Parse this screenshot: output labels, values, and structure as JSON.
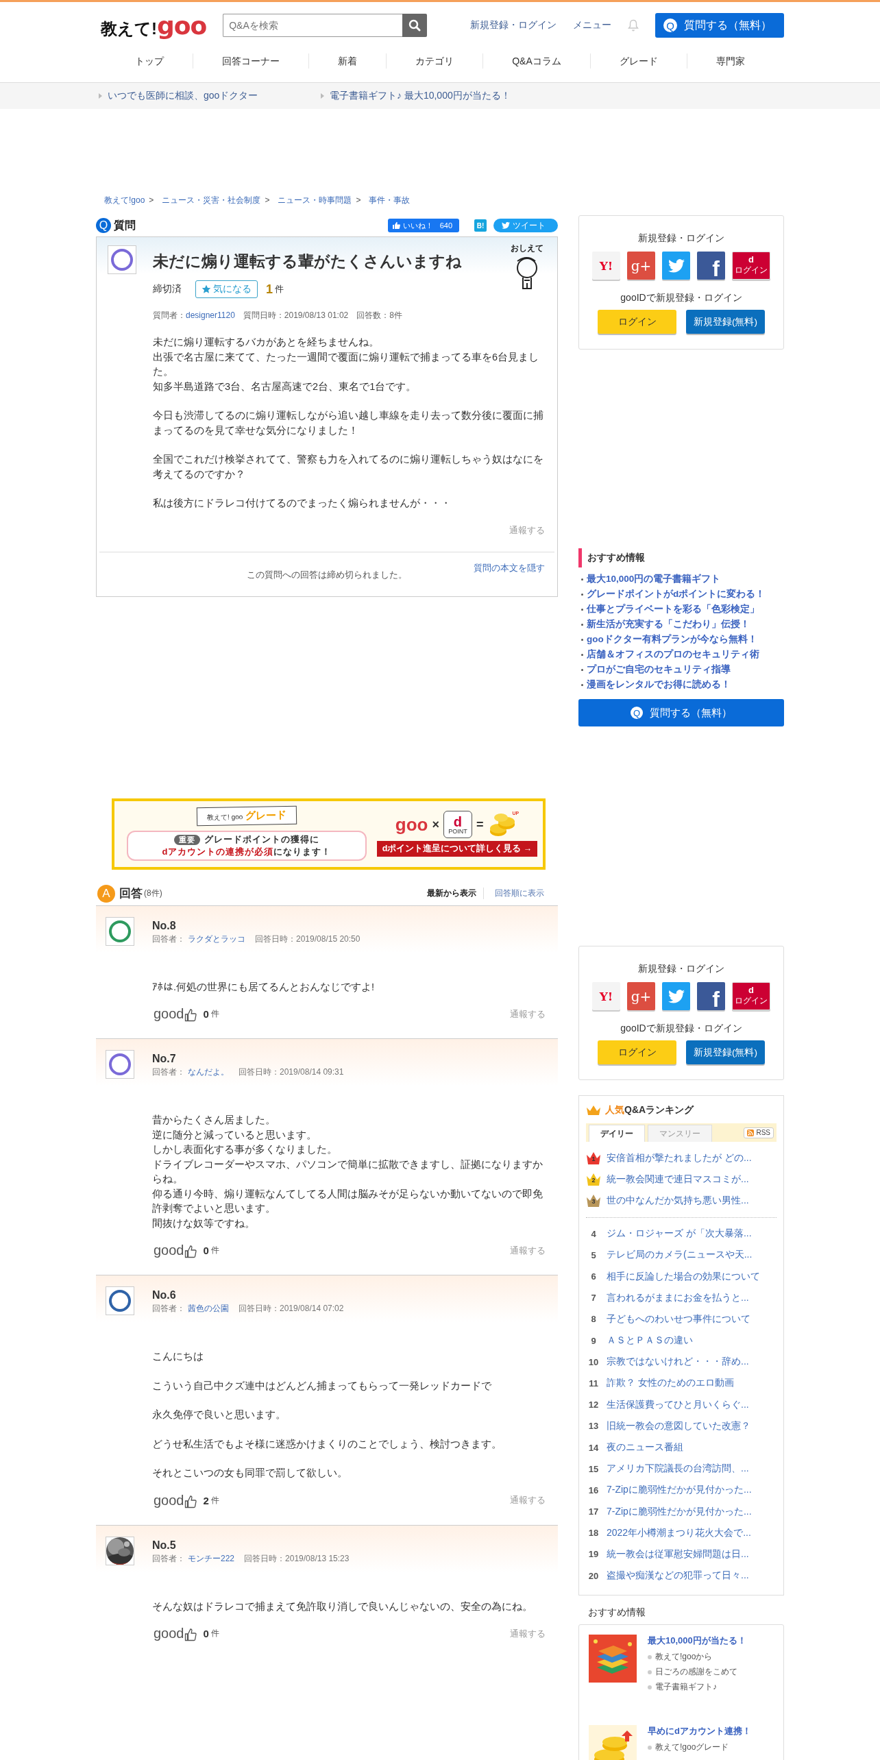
{
  "header": {
    "logo": {
      "text": "教えて!",
      "brand": "goo"
    },
    "search": {
      "placeholder": "Q&Aを検索"
    },
    "links": [
      "新規登録・ログイン",
      "メニュー"
    ],
    "ask_button": {
      "icon": "Q",
      "label": "質問する（無料）"
    },
    "nav": [
      "トップ",
      "回答コーナー",
      "新着",
      "カテゴリ",
      "Q&Aコラム",
      "グレード",
      "専門家"
    ]
  },
  "promo_links": [
    "いつでも医師に相談、gooドクター",
    "電子書籍ギフト♪ 最大10,000円が当たる！"
  ],
  "breadcrumb": [
    {
      "label": "教えて!goo",
      "sep": ">"
    },
    {
      "label": "ニュース・災害・社会制度",
      "sep": ">"
    },
    {
      "label": "ニュース・時事問題",
      "sep": ">"
    },
    {
      "label": "事件・事故"
    }
  ],
  "question": {
    "badge": "Q",
    "section_label": "質問",
    "like_label": "いいね！",
    "like_count": "640",
    "hatena": "B!",
    "tweet": "ツイート",
    "mascot_text": "おしえて",
    "avatar": {
      "color": "#7a6ad8"
    },
    "title": "未だに煽り運転する輩がたくさんいますね",
    "status": "締切済",
    "watch_button": "気になる",
    "watch_count": "1",
    "watch_unit": "件",
    "meta": [
      {
        "label": "質問者：",
        "value": "designer1120",
        "kind": "link"
      },
      {
        "label": "質問日時：",
        "value": "2019/08/13 01:02",
        "kind": "plain"
      },
      {
        "label": "回答数：",
        "value": "8件",
        "kind": "plain"
      }
    ],
    "body": [
      [
        "未だに煽り運転するバカがあとを経ちませんね。",
        "出張で名古屋に来てて、たった一週間で覆面に煽り運転で捕まってる車を6台見ました。",
        "知多半島道路で3台、名古屋高速で2台、東名で1台です。"
      ],
      [
        "今日も渋滞してるのに煽り運転しながら追い越し車線を走り去って数分後に覆面に捕まってるのを見て幸せな気分になりました！"
      ],
      [
        "全国でこれだけ検挙されてて、警察も力を入れてるのに煽り運転しちゃう奴はなにを考えてるのですか？"
      ],
      [
        "私は後方にドラレコ付けてるのでまったく煽られませんが・・・"
      ]
    ],
    "report": "通報する",
    "closed_notice": "この質問への回答は締め切られました。",
    "hide_link": "質問の本文を隠す"
  },
  "banner": {
    "ribbon_site": "教えて! goo",
    "ribbon_title": "グレード",
    "badge": "重要",
    "line1": "グレードポイントの獲得に",
    "line2_accent": "dアカウントの連携が必須",
    "line2_rest": "になります！",
    "goo": "goo",
    "times": "×",
    "dpoint_mark": "d",
    "dpoint_label": "POINT",
    "equals": "=",
    "up": "UP",
    "button": "dポイント進呈について詳しく見る →"
  },
  "answers_header": {
    "badge": "A",
    "label": "回答",
    "count": "(8件)",
    "sorts": [
      {
        "label": "最新から表示",
        "selected": true
      },
      {
        "label": "回答順に表示",
        "selected": false
      }
    ]
  },
  "answers": [
    {
      "number": "No.8",
      "avatar": {
        "kind": "icon",
        "color": "#2e9a5e"
      },
      "answerer_label": "回答者：",
      "answerer": "ラクダとラッコ",
      "date": "回答日時：2019/08/15 20:50",
      "body": [
        [
          "ｱﾎは.何処の世界にも居てるんとおんなじですよ!"
        ]
      ],
      "good": "good",
      "good_count": "0",
      "good_unit": "件",
      "report": "通報する"
    },
    {
      "number": "No.7",
      "avatar": {
        "kind": "icon",
        "color": "#7a6ad8"
      },
      "answerer_label": "回答者：",
      "answerer": "なんだよ。",
      "date": "回答日時：2019/08/14 09:31",
      "body": [
        [
          "昔からたくさん居ました。",
          "逆に随分と減っていると思います。",
          "しかし表面化する事が多くなりました。",
          "ドライブレコーダーやスマホ、パソコンで簡単に拡散できますし、証拠になりますからね。",
          "仰る通り今時、煽り運転なんてしてる人間は脳みそが足らないか動いてないので即免許剥奪でよいと思います。",
          "間抜けな奴等ですね。"
        ]
      ],
      "good": "good",
      "good_count": "0",
      "good_unit": "件",
      "report": "通報する"
    },
    {
      "number": "No.6",
      "avatar": {
        "kind": "icon",
        "color": "#2f63a8"
      },
      "answerer_label": "回答者：",
      "answerer": "茜色の公園",
      "date": "回答日時：2019/08/14 07:02",
      "body": [
        [
          "こんにちは"
        ],
        [
          "こういう自己中クズ連中はどんどん捕まってもらって一発レッドカードで"
        ],
        [
          "永久免停で良いと思います。"
        ],
        [
          "どうせ私生活でもよそ様に迷惑かけまくりのことでしょう、検討つきます。"
        ],
        [
          "それとこいつの女も同罪で罰して欲しい。"
        ]
      ],
      "good": "good",
      "good_count": "2",
      "good_unit": "件",
      "report": "通報する"
    },
    {
      "number": "No.5",
      "avatar": {
        "kind": "picture"
      },
      "answerer_label": "回答者：",
      "answerer": "モンチー222",
      "date": "回答日時：2019/08/13 15:23",
      "body": [
        [
          "そんな奴はドラレコで捕まえて免許取り消しで良いんじゃないの、安全の為にね。"
        ]
      ],
      "good": "good",
      "good_count": "0",
      "good_unit": "件",
      "report": "通報する"
    }
  ],
  "login_boxes": [
    {
      "title": "新規登録・ログイン",
      "social": [
        {
          "kind": "yahoo",
          "label": "Y!"
        },
        {
          "kind": "google",
          "label": "g+"
        },
        {
          "kind": "twitter"
        },
        {
          "kind": "facebook",
          "label": "f"
        },
        {
          "kind": "docomo",
          "label": "d",
          "sub": "ログイン"
        }
      ],
      "goo_title": "gooIDで新規登録・ログイン",
      "login": "ログイン",
      "register": "新規登録(無料)"
    },
    {
      "title": "新規登録・ログイン",
      "social": [
        {
          "kind": "yahoo",
          "label": "Y!"
        },
        {
          "kind": "google",
          "label": "g+"
        },
        {
          "kind": "twitter"
        },
        {
          "kind": "facebook",
          "label": "f"
        },
        {
          "kind": "docomo",
          "label": "d",
          "sub": "ログイン"
        }
      ],
      "goo_title": "gooIDで新規登録・ログイン",
      "login": "ログイン",
      "register": "新規登録(無料)"
    }
  ],
  "recommend": {
    "title": "おすすめ情報",
    "items": [
      "最大10,000円の電子書籍ギフト",
      "グレードポイントがdポイントに変わる！",
      "仕事とプライベートを彩る「色彩検定」",
      "新生活が充実する「こだわり」伝授！",
      "gooドクター有料プランが今なら無料！",
      "店舗＆オフィスのプロのセキュリティ術",
      "プロがご自宅のセキュリティ指導",
      "漫画をレンタルでお得に読める！"
    ]
  },
  "side_ask_button": {
    "icon": "Q",
    "label": "質問する（無料）"
  },
  "ranking": {
    "title_accent": "人気",
    "title": "Q&Aランキング",
    "tabs": [
      {
        "label": "デイリー",
        "selected": true
      },
      {
        "label": "マンスリー",
        "selected": false
      }
    ],
    "rss": "RSS",
    "items": [
      {
        "rank": "1",
        "kind": "crown",
        "color": "#e8382f",
        "title": "安倍首相が撃たれましたが どの..."
      },
      {
        "rank": "2",
        "kind": "crown",
        "color": "#f2c21b",
        "title": "統一教会関連で連日マスコミが..."
      },
      {
        "rank": "3",
        "kind": "crown",
        "color": "#b8965a",
        "title": "世の中なんだか気持ち悪い男性..."
      },
      {
        "rank": "4",
        "kind": "plain",
        "title": "ジム・ロジャーズ が「次大暴落..."
      },
      {
        "rank": "5",
        "kind": "plain",
        "title": "テレビ局のカメラ(ニュースや天..."
      },
      {
        "rank": "6",
        "kind": "plain",
        "title": "相手に反論した場合の効果について"
      },
      {
        "rank": "7",
        "kind": "plain",
        "title": "言われるがままにお金を払うと..."
      },
      {
        "rank": "8",
        "kind": "plain",
        "title": "子どもへのわいせつ事件について"
      },
      {
        "rank": "9",
        "kind": "plain",
        "title": "ＡＳとＰＡＳの違い"
      },
      {
        "rank": "10",
        "kind": "plain",
        "title": "宗教ではないけれど・・・辞め..."
      },
      {
        "rank": "11",
        "kind": "plain",
        "title": "詐欺？ 女性のためのエロ動画"
      },
      {
        "rank": "12",
        "kind": "plain",
        "title": "生活保護費ってひと月いくらぐ..."
      },
      {
        "rank": "13",
        "kind": "plain",
        "title": "旧統一教会の意図していた改憲？"
      },
      {
        "rank": "14",
        "kind": "plain",
        "title": "夜のニュース番組"
      },
      {
        "rank": "15",
        "kind": "plain",
        "title": "アメリカ下院議長の台湾訪問、..."
      },
      {
        "rank": "16",
        "kind": "plain",
        "title": "7-Zipに脆弱性だかが見付かった..."
      },
      {
        "rank": "17",
        "kind": "plain",
        "title": "7-Zipに脆弱性だかが見付かった..."
      },
      {
        "rank": "18",
        "kind": "plain",
        "title": "2022年小樽潮まつり花火大会で..."
      },
      {
        "rank": "19",
        "kind": "plain",
        "title": "統一教会は従軍慰安婦問題は日..."
      },
      {
        "rank": "20",
        "kind": "plain",
        "title": "盗撮や痴漢などの犯罪って日々..."
      }
    ]
  },
  "recommend2": {
    "title": "おすすめ情報",
    "items": [
      {
        "kind": "picture",
        "headline": "最大10,000円が当たる！",
        "links": [
          "教えて!gooから",
          "日ごろの感謝をこめて",
          "電子書籍ギフト♪"
        ]
      },
      {
        "kind": "picture",
        "headline": "早めにdアカウント連携！",
        "links": [
          "教えて!gooグレード"
        ]
      }
    ]
  }
}
